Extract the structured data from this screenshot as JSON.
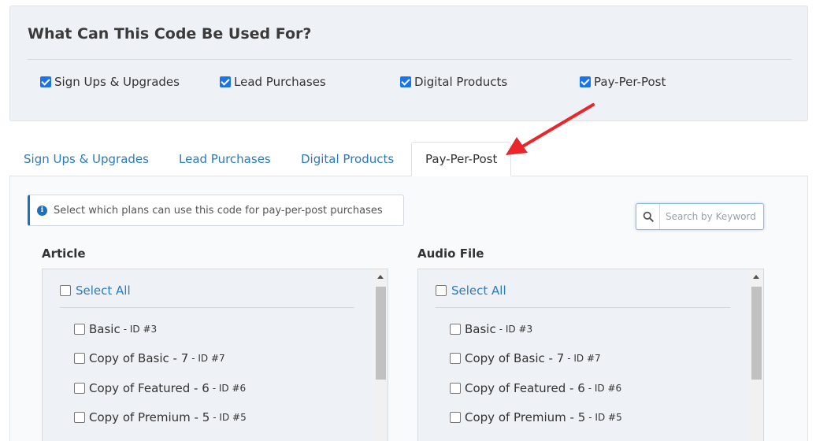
{
  "usage": {
    "title": "What Can This Code Be Used For?",
    "options": [
      {
        "label": "Sign Ups & Upgrades",
        "checked": true
      },
      {
        "label": "Lead Purchases",
        "checked": true
      },
      {
        "label": "Digital Products",
        "checked": true
      },
      {
        "label": "Pay-Per-Post",
        "checked": true
      }
    ]
  },
  "tabs": [
    {
      "label": "Sign Ups & Upgrades",
      "active": false
    },
    {
      "label": "Lead Purchases",
      "active": false
    },
    {
      "label": "Digital Products",
      "active": false
    },
    {
      "label": "Pay-Per-Post",
      "active": true
    }
  ],
  "info": {
    "icon": "info-icon",
    "text": "Select which plans can use this code for pay-per-post purchases"
  },
  "search": {
    "placeholder": "Search by Keyword",
    "value": ""
  },
  "columns": [
    {
      "title": "Article",
      "select_all": "Select All",
      "items": [
        {
          "name": "Basic",
          "id": "- ID #3"
        },
        {
          "name": "Copy of Basic - 7",
          "id": "- ID #7"
        },
        {
          "name": "Copy of Featured - 6",
          "id": "- ID #6"
        },
        {
          "name": "Copy of Premium - 5",
          "id": "- ID #5"
        }
      ]
    },
    {
      "title": "Audio File",
      "select_all": "Select All",
      "items": [
        {
          "name": "Basic",
          "id": "- ID #3"
        },
        {
          "name": "Copy of Basic - 7",
          "id": "- ID #7"
        },
        {
          "name": "Copy of Featured - 6",
          "id": "- ID #6"
        },
        {
          "name": "Copy of Premium - 5",
          "id": "- ID #5"
        }
      ]
    }
  ],
  "colors": {
    "accent": "#2a7abf",
    "checkbox": "#1a73e8",
    "annotation_arrow": "#e8262c"
  }
}
